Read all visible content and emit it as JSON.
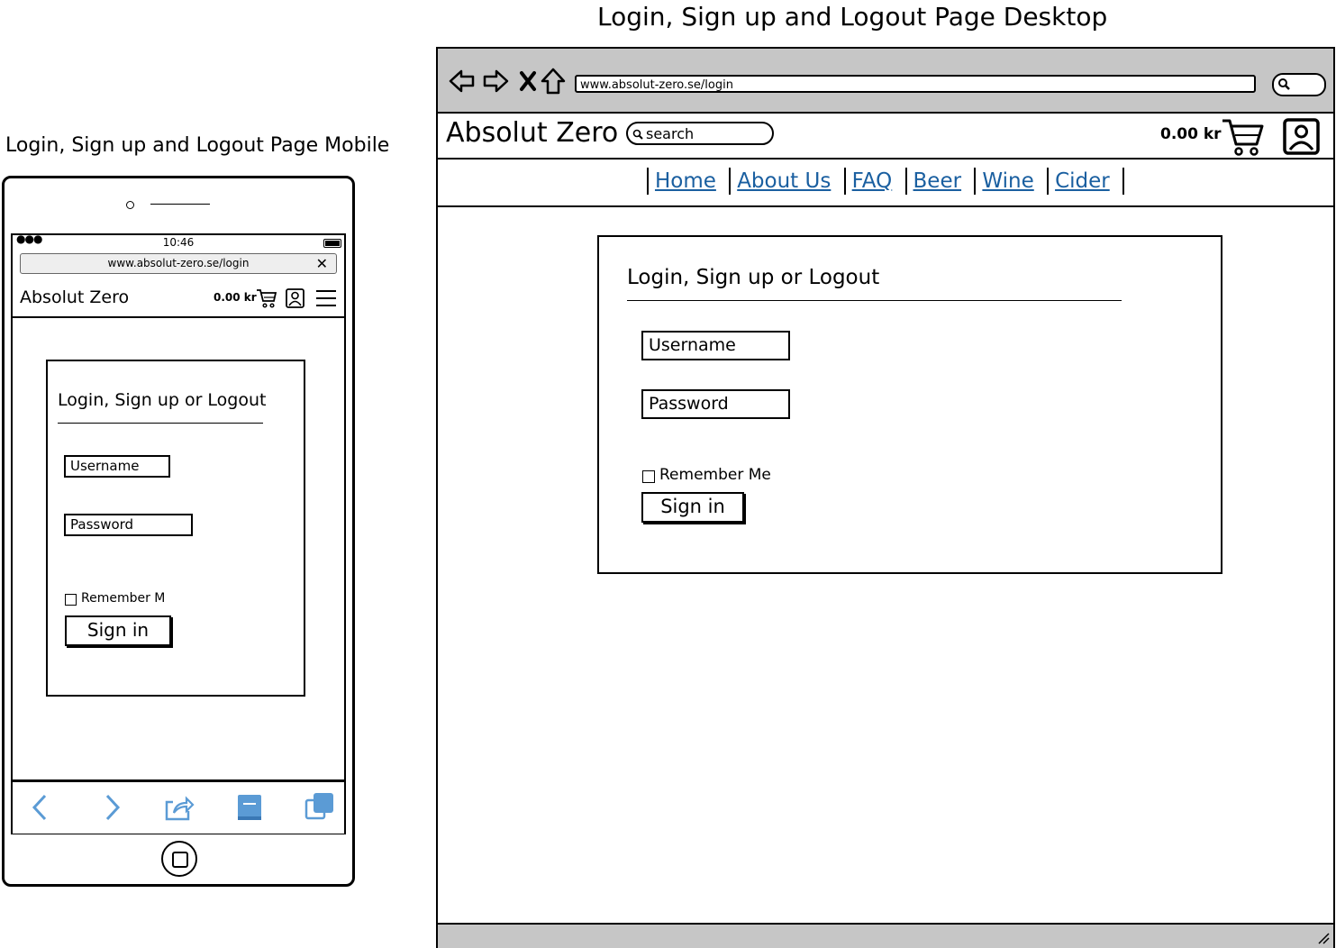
{
  "mobile": {
    "caption": "Login, Sign up and Logout Page Mobile",
    "status": {
      "time": "10:46"
    },
    "url": "www.absolut-zero.se/login",
    "header": {
      "brand": "Absolut Zero",
      "price": "0.00 kr"
    },
    "card": {
      "title": "Login, Sign up or Logout",
      "username_placeholder": "Username",
      "password_placeholder": "Password",
      "remember_label": "Remember M",
      "signin_label": "Sign in"
    },
    "toolbar": {
      "icons": [
        "back-icon",
        "forward-icon",
        "share-icon",
        "bookmarks-icon",
        "tabs-icon"
      ],
      "color": "#5b9bd5"
    }
  },
  "desktop": {
    "caption": "Login, Sign up and Logout Page Desktop",
    "url": "www.absolut-zero.se/login",
    "header": {
      "brand": "Absolut Zero",
      "search_placeholder": "search",
      "price": "0.00 kr"
    },
    "nav": [
      "Home",
      "About Us",
      "FAQ",
      "Beer",
      "Wine",
      "Cider"
    ],
    "card": {
      "title": "Login, Sign up or Logout",
      "username_placeholder": "Username",
      "password_placeholder": "Password",
      "remember_label": "Remember Me",
      "signin_label": "Sign in"
    },
    "colors": {
      "link": "#1a5fa0",
      "chrome": "#c6c6c6"
    }
  }
}
